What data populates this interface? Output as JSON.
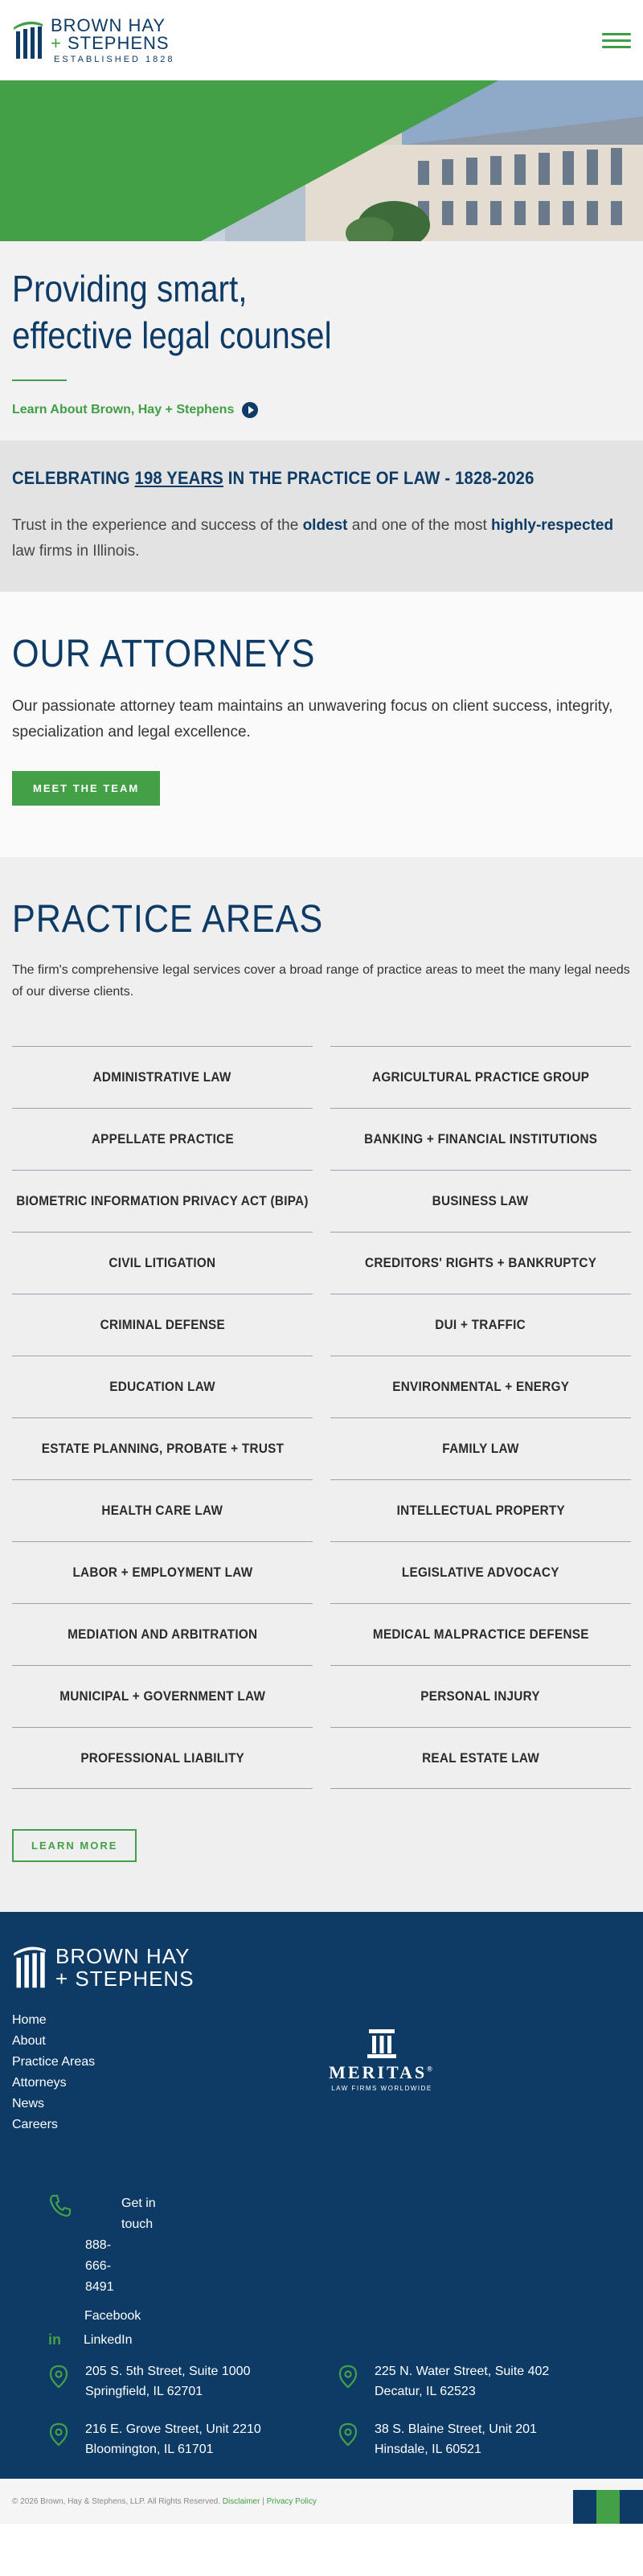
{
  "header": {
    "logo_line1": "BROWN HAY",
    "logo_plus": "+",
    "logo_line2": "STEPHENS",
    "logo_est": "ESTABLISHED 1828",
    "menu_icon": "hamburger-menu-icon"
  },
  "intro": {
    "headline_line1": "Providing smart,",
    "headline_line2": "effective legal counsel",
    "link_label": "Learn About Brown, Hay + Stephens"
  },
  "celebrate": {
    "title_pre": "CELEBRATING ",
    "title_years": "198 YEARS",
    "title_post": " IN THE PRACTICE OF LAW - 1828-2026",
    "text_1": "Trust in the experience and success of the ",
    "text_bold_1": "oldest",
    "text_2": " and one of the most ",
    "text_bold_2": "highly-respected",
    "text_3": " law firms in Illinois."
  },
  "attorneys": {
    "title": "OUR ATTORNEYS",
    "text": "Our passionate attorney team maintains an unwavering focus on client success, integrity, specialization and legal excellence.",
    "button": "MEET THE TEAM"
  },
  "practice": {
    "title": "PRACTICE AREAS",
    "text": "The firm's comprehensive legal services cover a broad range of practice areas to meet the many legal needs of our diverse clients.",
    "areas": [
      "ADMINISTRATIVE LAW",
      "AGRICULTURAL PRACTICE GROUP",
      "APPELLATE PRACTICE",
      "BANKING + FINANCIAL INSTITUTIONS",
      "BIOMETRIC INFORMATION PRIVACY ACT (BIPA)",
      "BUSINESS LAW",
      "CIVIL LITIGATION",
      "CREDITORS' RIGHTS + BANKRUPTCY",
      "CRIMINAL DEFENSE",
      "DUI + TRAFFIC",
      "EDUCATION LAW",
      "ENVIRONMENTAL + ENERGY",
      "ESTATE PLANNING, PROBATE + TRUST",
      "FAMILY LAW",
      "HEALTH CARE LAW",
      "INTELLECTUAL PROPERTY",
      "LABOR + EMPLOYMENT LAW",
      "LEGISLATIVE ADVOCACY",
      "MEDIATION AND ARBITRATION",
      "MEDICAL MALPRACTICE DEFENSE",
      "MUNICIPAL + GOVERNMENT LAW",
      "PERSONAL INJURY",
      "PROFESSIONAL LIABILITY",
      "REAL ESTATE LAW"
    ],
    "button": "LEARN MORE"
  },
  "footer": {
    "logo_line1": "BROWN HAY",
    "logo_line2": "+ STEPHENS",
    "nav": [
      "Home",
      "About",
      "Practice Areas",
      "Attorneys",
      "News",
      "Careers"
    ],
    "meritas": "MERITAS",
    "meritas_reg": "®",
    "meritas_sub": "LAW FIRMS WORLDWIDE",
    "touch_label": "Get in touch",
    "phone": "888-666-8491",
    "facebook": "Facebook",
    "linkedin": "LinkedIn",
    "linkedin_icon_text": "in",
    "offices": [
      {
        "line1": "205 S. 5th Street, Suite 1000",
        "line2": "Springfield, IL 62701"
      },
      {
        "line1": "225 N. Water Street, Suite 402",
        "line2": "Decatur, IL 62523"
      },
      {
        "line1": "216 E. Grove Street, Unit 2210",
        "line2": "Bloomington, IL 61701"
      },
      {
        "line1": "38 S. Blaine Street, Unit 201",
        "line2": "Hinsdale, IL  60521"
      }
    ],
    "copyright": "© 2026 Brown, Hay & Stephens, LLP. All Rights Reserved.",
    "disclaimer": "Disclaimer",
    "separator": "|",
    "privacy": "Privacy Policy"
  },
  "colors": {
    "navy": "#0d3b66",
    "green": "#43a047",
    "light_bg": "#f2f2f2"
  }
}
